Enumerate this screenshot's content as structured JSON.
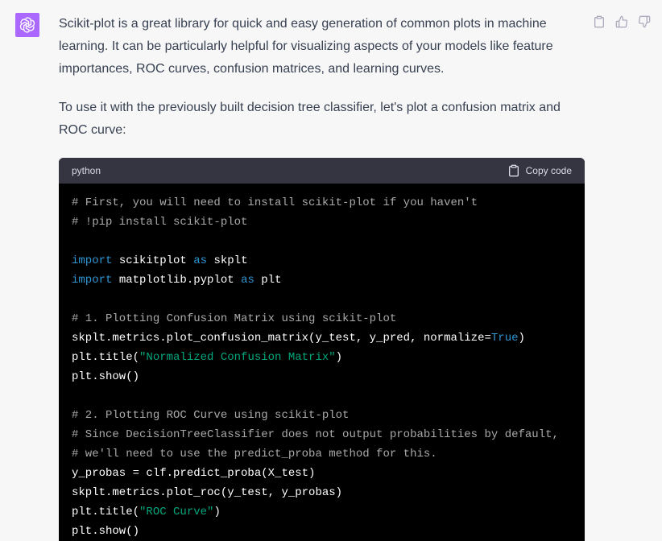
{
  "message": {
    "avatar_icon": "openai-logo-icon",
    "paragraphs": [
      "Scikit-plot is a great library for quick and easy generation of common plots in machine learning. It can be particularly helpful for visualizing aspects of your models like feature importances, ROC curves, confusion matrices, and learning curves.",
      "To use it with the previously built decision tree classifier, let's plot a confusion matrix and ROC curve:"
    ],
    "actions": [
      {
        "icon": "clipboard-icon"
      },
      {
        "icon": "thumbs-up-icon"
      },
      {
        "icon": "thumbs-down-icon"
      }
    ]
  },
  "code_block": {
    "language": "python",
    "copy_label": "Copy code",
    "lines": [
      [
        {
          "t": "# First, you will need to install scikit-plot if you haven't",
          "k": "comment"
        }
      ],
      [
        {
          "t": "# !pip install scikit-plot",
          "k": "comment"
        }
      ],
      [],
      [
        {
          "t": "import",
          "k": "keyword"
        },
        {
          "t": " scikitplot ",
          "k": "plain"
        },
        {
          "t": "as",
          "k": "keyword"
        },
        {
          "t": " skplt",
          "k": "plain"
        }
      ],
      [
        {
          "t": "import",
          "k": "keyword"
        },
        {
          "t": " matplotlib.pyplot ",
          "k": "plain"
        },
        {
          "t": "as",
          "k": "keyword"
        },
        {
          "t": " plt",
          "k": "plain"
        }
      ],
      [],
      [
        {
          "t": "# 1. Plotting Confusion Matrix using scikit-plot",
          "k": "comment"
        }
      ],
      [
        {
          "t": "skplt.metrics.plot_confusion_matrix(y_test, y_pred, normalize=",
          "k": "plain"
        },
        {
          "t": "True",
          "k": "builtin"
        },
        {
          "t": ")",
          "k": "plain"
        }
      ],
      [
        {
          "t": "plt.title(",
          "k": "plain"
        },
        {
          "t": "\"Normalized Confusion Matrix\"",
          "k": "string"
        },
        {
          "t": ")",
          "k": "plain"
        }
      ],
      [
        {
          "t": "plt.show()",
          "k": "plain"
        }
      ],
      [],
      [
        {
          "t": "# 2. Plotting ROC Curve using scikit-plot",
          "k": "comment"
        }
      ],
      [
        {
          "t": "# Since DecisionTreeClassifier does not output probabilities by default,",
          "k": "comment"
        }
      ],
      [
        {
          "t": "# we'll need to use the predict_proba method for this.",
          "k": "comment"
        }
      ],
      [
        {
          "t": "y_probas = clf.predict_proba(X_test)",
          "k": "plain"
        }
      ],
      [
        {
          "t": "skplt.metrics.plot_roc(y_test, y_probas)",
          "k": "plain"
        }
      ],
      [
        {
          "t": "plt.title(",
          "k": "plain"
        },
        {
          "t": "\"ROC Curve\"",
          "k": "string"
        },
        {
          "t": ")",
          "k": "plain"
        }
      ],
      [
        {
          "t": "plt.show()",
          "k": "plain"
        }
      ]
    ]
  },
  "colors": {
    "page_bg": "#f7f7f8",
    "avatar_bg": "#ab68ff",
    "code_header_bg": "#343541",
    "code_bg": "#000000",
    "comment": "#a9a9a9",
    "keyword": "#2e95d3",
    "string": "#00a67d"
  }
}
